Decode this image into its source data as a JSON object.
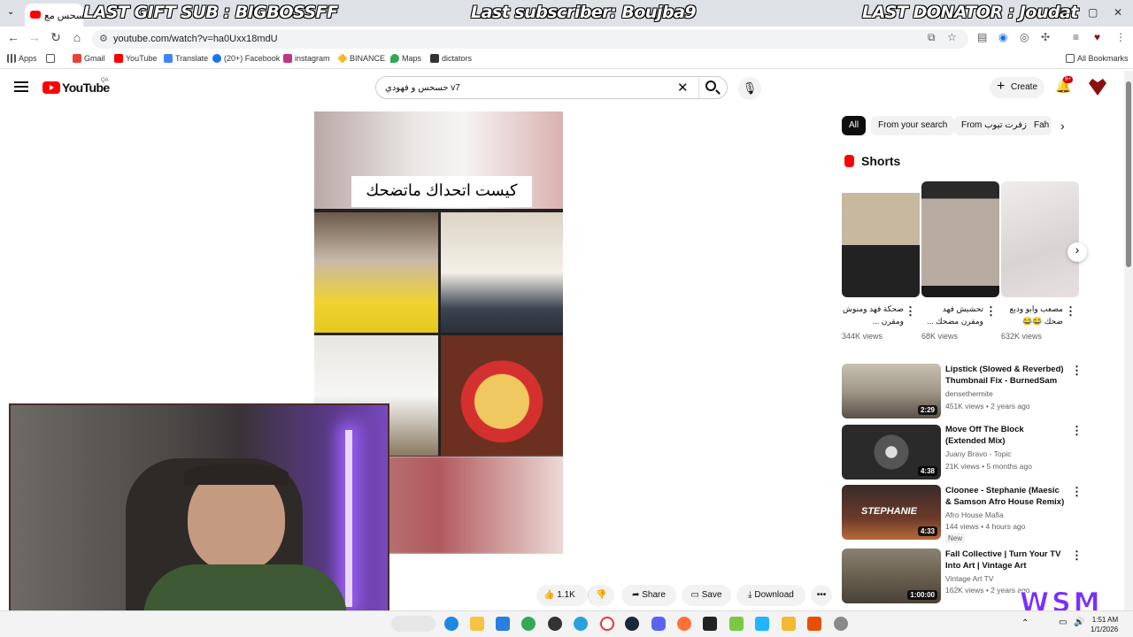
{
  "browser": {
    "tab_title": "حسحس مع",
    "url": "youtube.com/watch?v=ha0Uxx18mdU",
    "bookmarks": [
      {
        "label": "Apps",
        "color": "#555555"
      },
      {
        "label": "",
        "color": "#555555"
      },
      {
        "label": "Gmail",
        "color": "#ea4335"
      },
      {
        "label": "YouTube",
        "color": "#ff0000"
      },
      {
        "label": "Translate",
        "color": "#4285f4"
      },
      {
        "label": "(20+) Facebook",
        "color": "#1877f2"
      },
      {
        "label": "instagram",
        "color": "#c13584"
      },
      {
        "label": "BINANCE",
        "color": "#f3ba2f"
      },
      {
        "label": "Maps",
        "color": "#34a853"
      },
      {
        "label": "dictators",
        "color": "#333333"
      }
    ],
    "all_bookmarks": "All Bookmarks"
  },
  "stream_overlay": {
    "gift": "LAST GIFT SUB : BIGBOSSFF",
    "subscriber": "Last subscriber: Boujba9",
    "donator": "LAST DONATOR : Joudat",
    "brand": "WSM"
  },
  "youtube": {
    "logo": "YouTube",
    "country": "QA",
    "search_query": "حسحس و فهودي v7",
    "create_label": "Create",
    "notif_badge": "9+",
    "video_caption": "كيست اتحداك ماتضحك",
    "actions": {
      "likes": "1.1K",
      "share": "Share",
      "save": "Save",
      "download": "Download"
    },
    "chips": [
      "All",
      "From your search",
      "From زفرت تيوب",
      "Fah"
    ],
    "shorts_heading": "Shorts",
    "shorts": [
      {
        "title": "ضحكة فهد ومنوش ومقرن ...",
        "views": "344K views"
      },
      {
        "title": "تحشيش فهد ومقرن مضحك ...",
        "views": "68K views"
      },
      {
        "title": "مصعب وابو وديع ضحك 😂😂",
        "views": "632K views"
      }
    ],
    "recommendations": [
      {
        "title": "Lipstick (Slowed & Reverbed) Thumbnail Fix - BurnedSam",
        "channel": "densethermite",
        "meta": "451K views • 2 years ago",
        "duration": "2:29",
        "badge": ""
      },
      {
        "title": "Move Off The Block (Extended Mix)",
        "channel": "Juany Bravo - Topic",
        "meta": "21K views • 5 months ago",
        "duration": "4:38",
        "badge": ""
      },
      {
        "title": "Cloonee - Stephanie (Maesic & Samson Afro House Remix)",
        "channel": "Afro House Mafia",
        "meta": "144 views • 4 hours ago",
        "duration": "4:33",
        "badge": "New"
      },
      {
        "title": "Fall Collective | Turn Your TV Into Art | Vintage Art Slidesho...",
        "channel": "Vintage Art TV",
        "meta": "162K views • 2 years ago",
        "duration": "1:00:00",
        "badge": ""
      }
    ]
  },
  "taskbar": {
    "time": "1:51 AM",
    "date": "1/1/2026"
  }
}
